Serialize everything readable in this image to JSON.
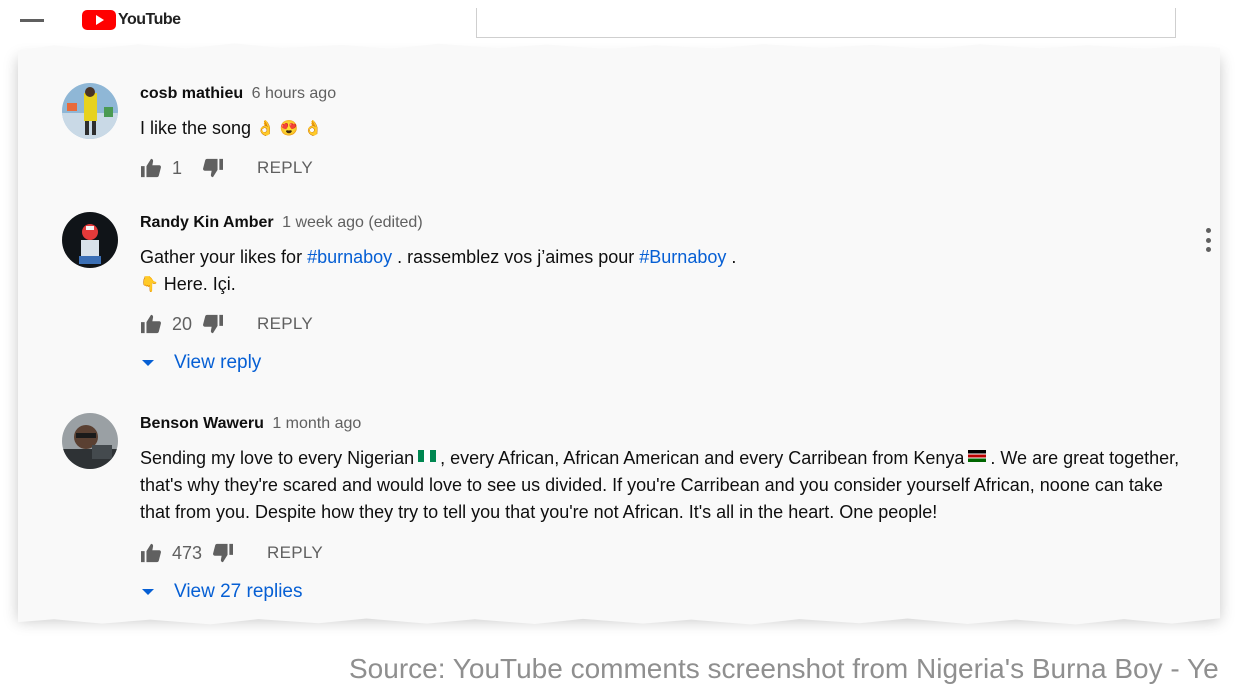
{
  "header": {
    "logo_text": "YouTube"
  },
  "comments": [
    {
      "author": "cosb mathieu",
      "time": "6 hours ago",
      "text_before": "I like the song",
      "likes": "1",
      "reply_label": "REPLY"
    },
    {
      "author": "Randy Kin Amber",
      "time": "1 week ago (edited)",
      "text_parts": [
        "Gather your likes for",
        "#burnaboy",
        ". rassemblez vos j’aimes pour",
        "#Burnaboy",
        "."
      ],
      "second_line": "Here. Içi.",
      "likes": "20",
      "reply_label": "REPLY",
      "view_replies": "View reply"
    },
    {
      "author": "Benson Waweru",
      "time": "1 month ago",
      "text_parts": [
        "Sending my love to every Nigerian",
        ", every African, African American and every Carribean from Kenya",
        ". We are great together, that's why they're scared and would love to see us divided. If you're Carribean and you consider yourself African, noone can take that from you. Despite how they try to tell you that you're not African. It's all in the heart. One people!"
      ],
      "likes": "473",
      "reply_label": "REPLY",
      "view_replies": "View 27 replies"
    }
  ],
  "caption": "Source: YouTube comments screenshot from Nigeria's Burna Boy - Ye",
  "colors": {
    "link": "#065fd4",
    "meta": "#606060",
    "brand": "#ff0000"
  }
}
